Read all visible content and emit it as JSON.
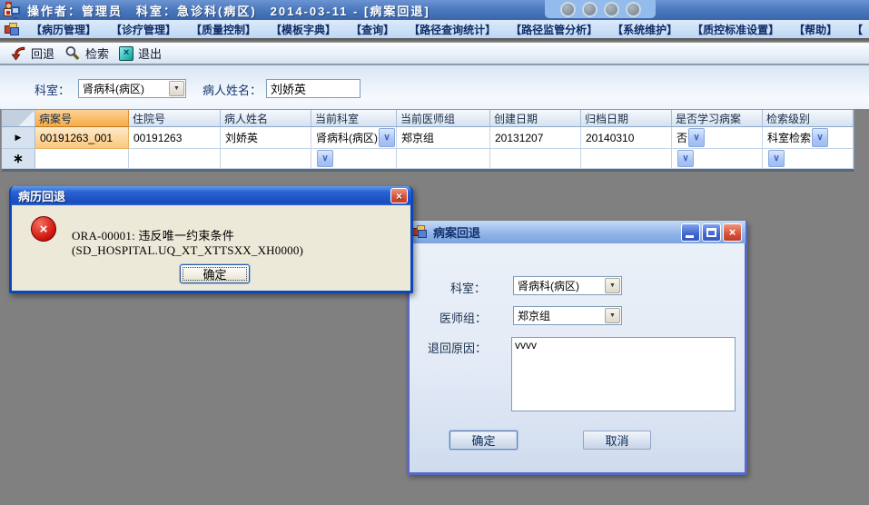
{
  "title_bar": {
    "title": "操作者：管理员　科室：急诊科(病区)　2014-03-11 - [病案回退]"
  },
  "menu": {
    "items": [
      "【病历管理】",
      "【诊疗管理】",
      "【质量控制】",
      "【模板字典】",
      "【查询】",
      "【路径查询统计】",
      "【路径监管分析】",
      "【系统维护】",
      "【质控标准设置】",
      "【帮助】",
      "【"
    ]
  },
  "toolbar": {
    "back_label": "回退",
    "search_label": "检索",
    "exit_label": "退出"
  },
  "filter": {
    "dept_label": "科室：",
    "dept_value": "肾病科(病区)",
    "patient_label": "病人姓名：",
    "patient_value": "刘娇英"
  },
  "table": {
    "columns": [
      "病案号",
      "住院号",
      "病人姓名",
      "当前科室",
      "当前医师组",
      "创建日期",
      "归档日期",
      "是否学习病案",
      "检索级别"
    ],
    "row": {
      "case_no": "00191263_001",
      "admission_no": "00191263",
      "patient_name": "刘娇英",
      "current_dept": "肾病科(病区)",
      "current_doctor_group": "郑京组",
      "create_date": "20131207",
      "archive_date": "20140310",
      "is_study_case": "否",
      "search_level": "科室检索"
    }
  },
  "error_dialog": {
    "title": "病历回退",
    "message": "ORA-00001: 违反唯一约束条件 (SD_HOSPITAL.UQ_XT_XTTSXX_XH0000)",
    "ok_label": "确定"
  },
  "return_dialog": {
    "title": "病案回退",
    "dept_label": "科室：",
    "dept_value": "肾病科(病区)",
    "group_label": "医师组：",
    "group_value": "郑京组",
    "reason_label": "退回原因：",
    "reason_value": "vvvv",
    "ok_label": "确定",
    "cancel_label": "取消"
  },
  "icons": {
    "combo_arrow": "▼",
    "grid_arrow": "∨",
    "close_x": "×",
    "exit_x": "×",
    "error_x": "×",
    "current_row_marker": "▶",
    "new_row_marker": "∗"
  },
  "colors": {
    "title_bar_blue": "#4876BC",
    "menu_bar_blue": "#C9DDF6",
    "sorted_header_orange": "#F7AC45",
    "desktop_gray": "#808080",
    "xp_dialog_beige": "#ECE9D8",
    "return_dialog_border": "#5A68C4",
    "error_title_blue": "#1A4BBC"
  }
}
